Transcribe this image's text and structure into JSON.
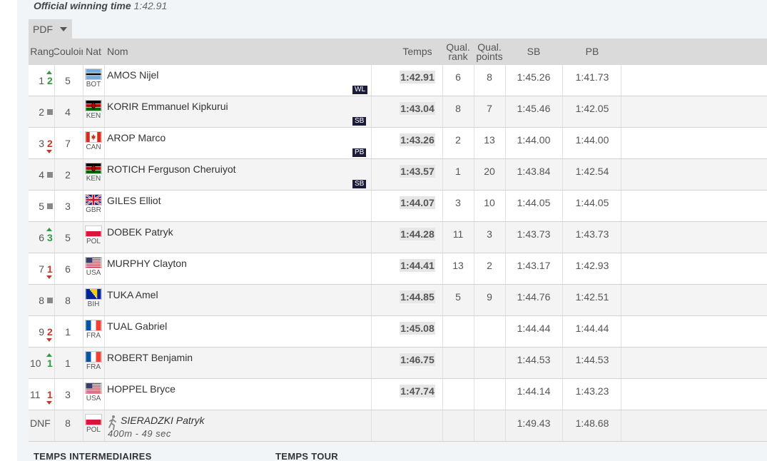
{
  "winning": {
    "label": "Official winning time",
    "time": "1:42.91"
  },
  "pdf_button": {
    "label": "PDF"
  },
  "columns": {
    "rang": "Rang",
    "couloir": "Couloir",
    "nat": "Nat",
    "nom": "Nom",
    "temps": "Temps",
    "qual_rank_1": "Qual.",
    "qual_rank_2": "rank",
    "qual_points_1": "Qual.",
    "qual_points_2": "points",
    "sb": "SB",
    "pb": "PB"
  },
  "rows": [
    {
      "rank": "1",
      "change": "2",
      "trend": "up",
      "lane": "5",
      "nat": "BOT",
      "flag": "bot-flag-icon",
      "name": "AMOS Nijel",
      "badge": "WL",
      "time": "1:42.91",
      "qrank": "6",
      "qpoints": "8",
      "sb": "1:45.26",
      "pb": "1:41.73"
    },
    {
      "rank": "2",
      "change": "",
      "trend": "same",
      "lane": "4",
      "nat": "KEN",
      "flag": "ken-flag-icon",
      "name": "KORIR Emmanuel Kipkurui",
      "badge": "SB",
      "time": "1:43.04",
      "qrank": "8",
      "qpoints": "7",
      "sb": "1:45.46",
      "pb": "1:42.05"
    },
    {
      "rank": "3",
      "change": "2",
      "trend": "down",
      "lane": "7",
      "nat": "CAN",
      "flag": "can-flag-icon",
      "name": "AROP Marco",
      "badge": "PB",
      "time": "1:43.26",
      "qrank": "2",
      "qpoints": "13",
      "sb": "1:44.00",
      "pb": "1:44.00"
    },
    {
      "rank": "4",
      "change": "",
      "trend": "same",
      "lane": "2",
      "nat": "KEN",
      "flag": "ken-flag-icon",
      "name": "ROTICH Ferguson Cheruiyot",
      "badge": "SB",
      "time": "1:43.57",
      "qrank": "1",
      "qpoints": "20",
      "sb": "1:43.84",
      "pb": "1:42.54"
    },
    {
      "rank": "5",
      "change": "",
      "trend": "same",
      "lane": "3",
      "nat": "GBR",
      "flag": "gbr-flag-icon",
      "name": "GILES Elliot",
      "badge": "",
      "time": "1:44.07",
      "qrank": "3",
      "qpoints": "10",
      "sb": "1:44.05",
      "pb": "1:44.05"
    },
    {
      "rank": "6",
      "change": "3",
      "trend": "up",
      "lane": "5",
      "nat": "POL",
      "flag": "pol-flag-icon",
      "name": "DOBEK Patryk",
      "badge": "",
      "time": "1:44.28",
      "qrank": "11",
      "qpoints": "3",
      "sb": "1:43.73",
      "pb": "1:43.73"
    },
    {
      "rank": "7",
      "change": "1",
      "trend": "down",
      "lane": "6",
      "nat": "USA",
      "flag": "usa-flag-icon",
      "name": "MURPHY Clayton",
      "badge": "",
      "time": "1:44.41",
      "qrank": "13",
      "qpoints": "2",
      "sb": "1:43.17",
      "pb": "1:42.93"
    },
    {
      "rank": "8",
      "change": "",
      "trend": "same",
      "lane": "8",
      "nat": "BIH",
      "flag": "bih-flag-icon",
      "name": "TUKA Amel",
      "badge": "",
      "time": "1:44.85",
      "qrank": "5",
      "qpoints": "9",
      "sb": "1:44.76",
      "pb": "1:42.51"
    },
    {
      "rank": "9",
      "change": "2",
      "trend": "down",
      "lane": "1",
      "nat": "FRA",
      "flag": "fra-flag-icon",
      "name": "TUAL Gabriel",
      "badge": "",
      "time": "1:45.08",
      "qrank": "",
      "qpoints": "",
      "sb": "1:44.44",
      "pb": "1:44.44"
    },
    {
      "rank": "10",
      "change": "1",
      "trend": "up",
      "lane": "1",
      "nat": "FRA",
      "flag": "fra-flag-icon",
      "name": "ROBERT Benjamin",
      "badge": "",
      "time": "1:46.75",
      "qrank": "",
      "qpoints": "",
      "sb": "1:44.53",
      "pb": "1:44.53"
    },
    {
      "rank": "11",
      "change": "1",
      "trend": "down",
      "lane": "3",
      "nat": "USA",
      "flag": "usa-flag-icon",
      "name": "HOPPEL Bryce",
      "badge": "",
      "time": "1:47.74",
      "qrank": "",
      "qpoints": "",
      "sb": "1:44.14",
      "pb": "1:43.23"
    }
  ],
  "dnf_row": {
    "rank": "DNF",
    "lane": "8",
    "nat": "POL",
    "flag": "pol-flag-icon",
    "icon": "runner-icon",
    "name": "SIERADZKI Patryk",
    "note": "400m - 49 sec",
    "sb": "1:49.43",
    "pb": "1:48.68"
  },
  "sections": {
    "intermediate": "TEMPS INTERMEDIAIRES",
    "lap": "TEMPS TOUR"
  }
}
